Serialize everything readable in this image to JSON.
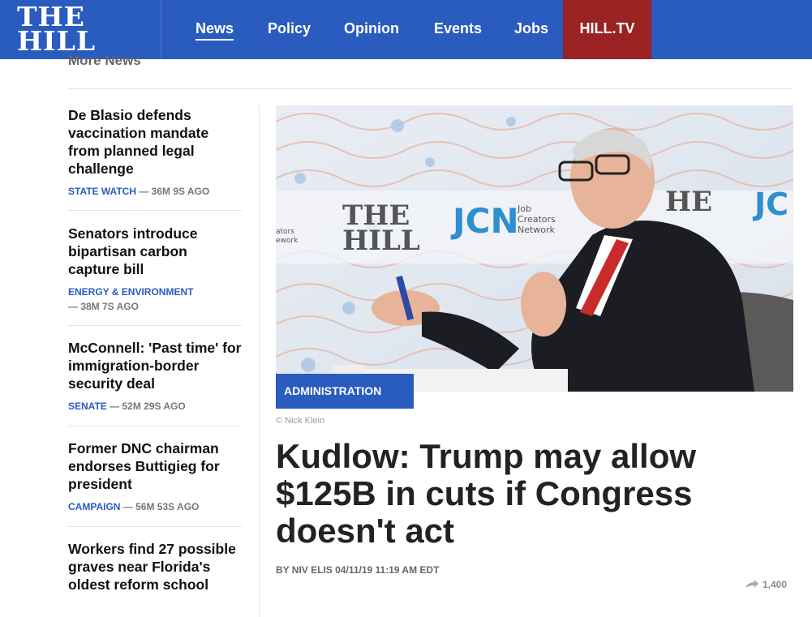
{
  "brand": {
    "line1": "THE",
    "line2": "HILL"
  },
  "nav": {
    "items": [
      {
        "label": "News"
      },
      {
        "label": "Policy"
      },
      {
        "label": "Opinion"
      },
      {
        "label": "Events"
      },
      {
        "label": "Jobs"
      },
      {
        "label": "HILL.TV"
      }
    ],
    "active": "News",
    "accent_color": "#2a5bbf",
    "hilltv_color": "#9b2222"
  },
  "sidebar": {
    "heading": "More News",
    "items": [
      {
        "title": "De Blasio defends vaccination mandate from planned legal challenge",
        "category": "STATE WATCH",
        "time": "— 36M 9S AGO"
      },
      {
        "title": "Senators introduce bipartisan carbon capture bill",
        "category": "ENERGY & ENVIRONMENT",
        "time": "— 38M 7S AGO"
      },
      {
        "title": "McConnell: 'Past time' for immigration-border security deal",
        "category": "SENATE",
        "time": "— 52M 29S AGO"
      },
      {
        "title": "Former DNC chairman endorses Buttigieg for president",
        "category": "CAMPAIGN",
        "time": "— 56M 53S AGO"
      },
      {
        "title": "Workers find 27 possible graves near Florida's oldest reform school",
        "category": "",
        "time": ""
      }
    ]
  },
  "article": {
    "category_badge": "ADMINISTRATION",
    "photo_credit": "© Nick Klein",
    "headline": "Kudlow: Trump may allow $125B in cuts if Congress doesn't act",
    "byline": "BY NIV ELIS 04/11/19 11:19 AM EDT",
    "share_count": "1,400",
    "hero_backdrop": {
      "brand_text_1": "THE",
      "brand_text_2": "HILL",
      "sponsor_short": "JCN",
      "sponsor_lines": [
        "Job",
        "Creators",
        "Network"
      ],
      "partial_left": "ators\nework",
      "partial_right_hill": "HE",
      "partial_right_jcn": "JC"
    }
  }
}
